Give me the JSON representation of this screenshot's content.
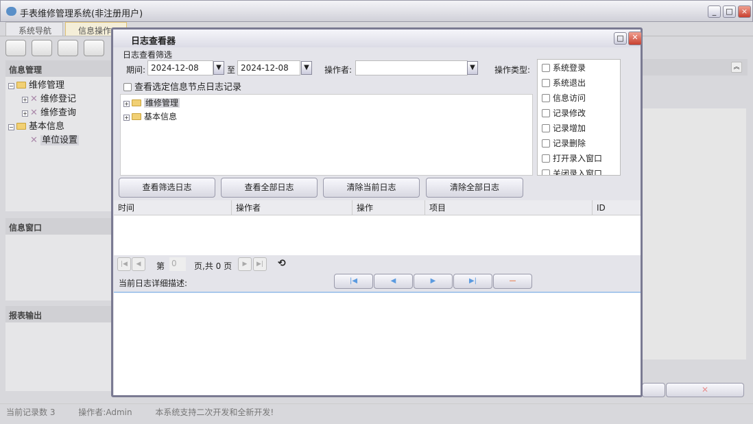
{
  "window": {
    "title": "手表维修管理系统(非注册用户)",
    "min": "_",
    "max": "□",
    "close": "×"
  },
  "tabs": [
    {
      "label": "系统导航"
    },
    {
      "label": "信息操作"
    }
  ],
  "sidebar": {
    "info_mgmt": "信息管理",
    "tree": [
      {
        "label": "维修管理"
      },
      {
        "label": "维修登记"
      },
      {
        "label": "维修查询"
      },
      {
        "label": "基本信息"
      },
      {
        "label": "单位设置"
      }
    ],
    "info_window": "信息窗口",
    "report": "报表输出"
  },
  "status": {
    "records": "当前记录数 3",
    "operator": "操作者:Admin",
    "note": "本系统支持二次开发和全新开发!"
  },
  "dialog": {
    "title": "日志查看器",
    "filter_group": "日志查看筛选",
    "period_label": "期间:",
    "date_from": "2024-12-08",
    "to_label": "至",
    "date_to": "2024-12-08",
    "operator_label": "操作者:",
    "operator_value": "",
    "optype_label": "操作类型:",
    "optypes": [
      {
        "label": "系统登录",
        "checked": false
      },
      {
        "label": "系统退出",
        "checked": false
      },
      {
        "label": "信息访问",
        "checked": false
      },
      {
        "label": "记录修改",
        "checked": false
      },
      {
        "label": "记录增加",
        "checked": false
      },
      {
        "label": "记录删除",
        "checked": false
      },
      {
        "label": "打开录入窗口",
        "checked": false
      },
      {
        "label": "关闭录入窗口",
        "checked": false
      }
    ],
    "node_checkbox": "查看选定信息节点日志记录",
    "node_tree": [
      {
        "label": "维修管理"
      },
      {
        "label": "基本信息"
      }
    ],
    "buttons": {
      "view_filtered": "查看筛选日志",
      "view_all": "查看全部日志",
      "clear_current": "清除当前日志",
      "clear_all": "清除全部日志"
    },
    "columns": [
      "时间",
      "操作者",
      "操作",
      "项目",
      "ID"
    ],
    "rows": [],
    "pager": {
      "page_prefix": "第",
      "page_value": "0",
      "page_suffix": "页,共 0 页"
    },
    "detail_label": "当前日志详细描述:"
  }
}
